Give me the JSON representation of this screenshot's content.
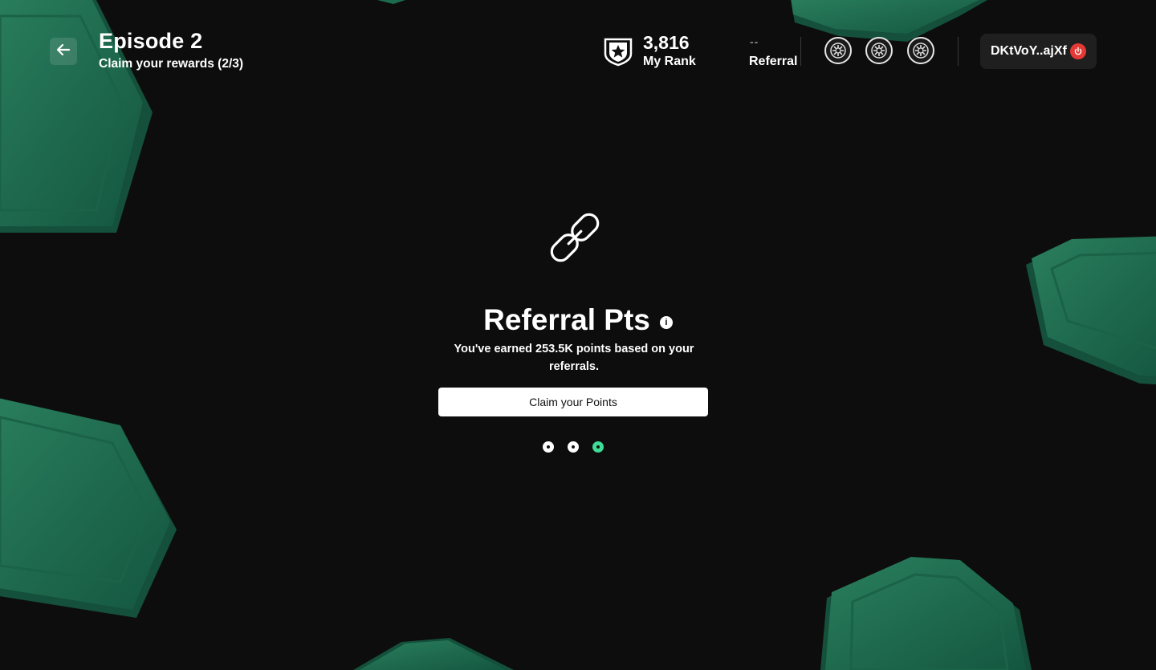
{
  "header": {
    "title": "Episode 2",
    "subtitle": "Claim your rewards (2/3)",
    "rank": {
      "value": "3,816",
      "label": "My Rank"
    },
    "referral": {
      "value": "--",
      "label": "Referral"
    },
    "badges": [
      "badge-icon",
      "badge-icon",
      "badge-icon"
    ],
    "wallet": {
      "address": "DKtVoY..ajXf"
    }
  },
  "main": {
    "title": "Referral Pts",
    "description": "You've earned 253.5K points based on your referrals.",
    "claim_label": "Claim your Points",
    "pagination": {
      "total": 3,
      "active": 3
    }
  },
  "colors": {
    "background": "#0d0d0d",
    "accent": "#3ddc97",
    "hex_green": "#1d6b4f",
    "power": "#e53935"
  }
}
